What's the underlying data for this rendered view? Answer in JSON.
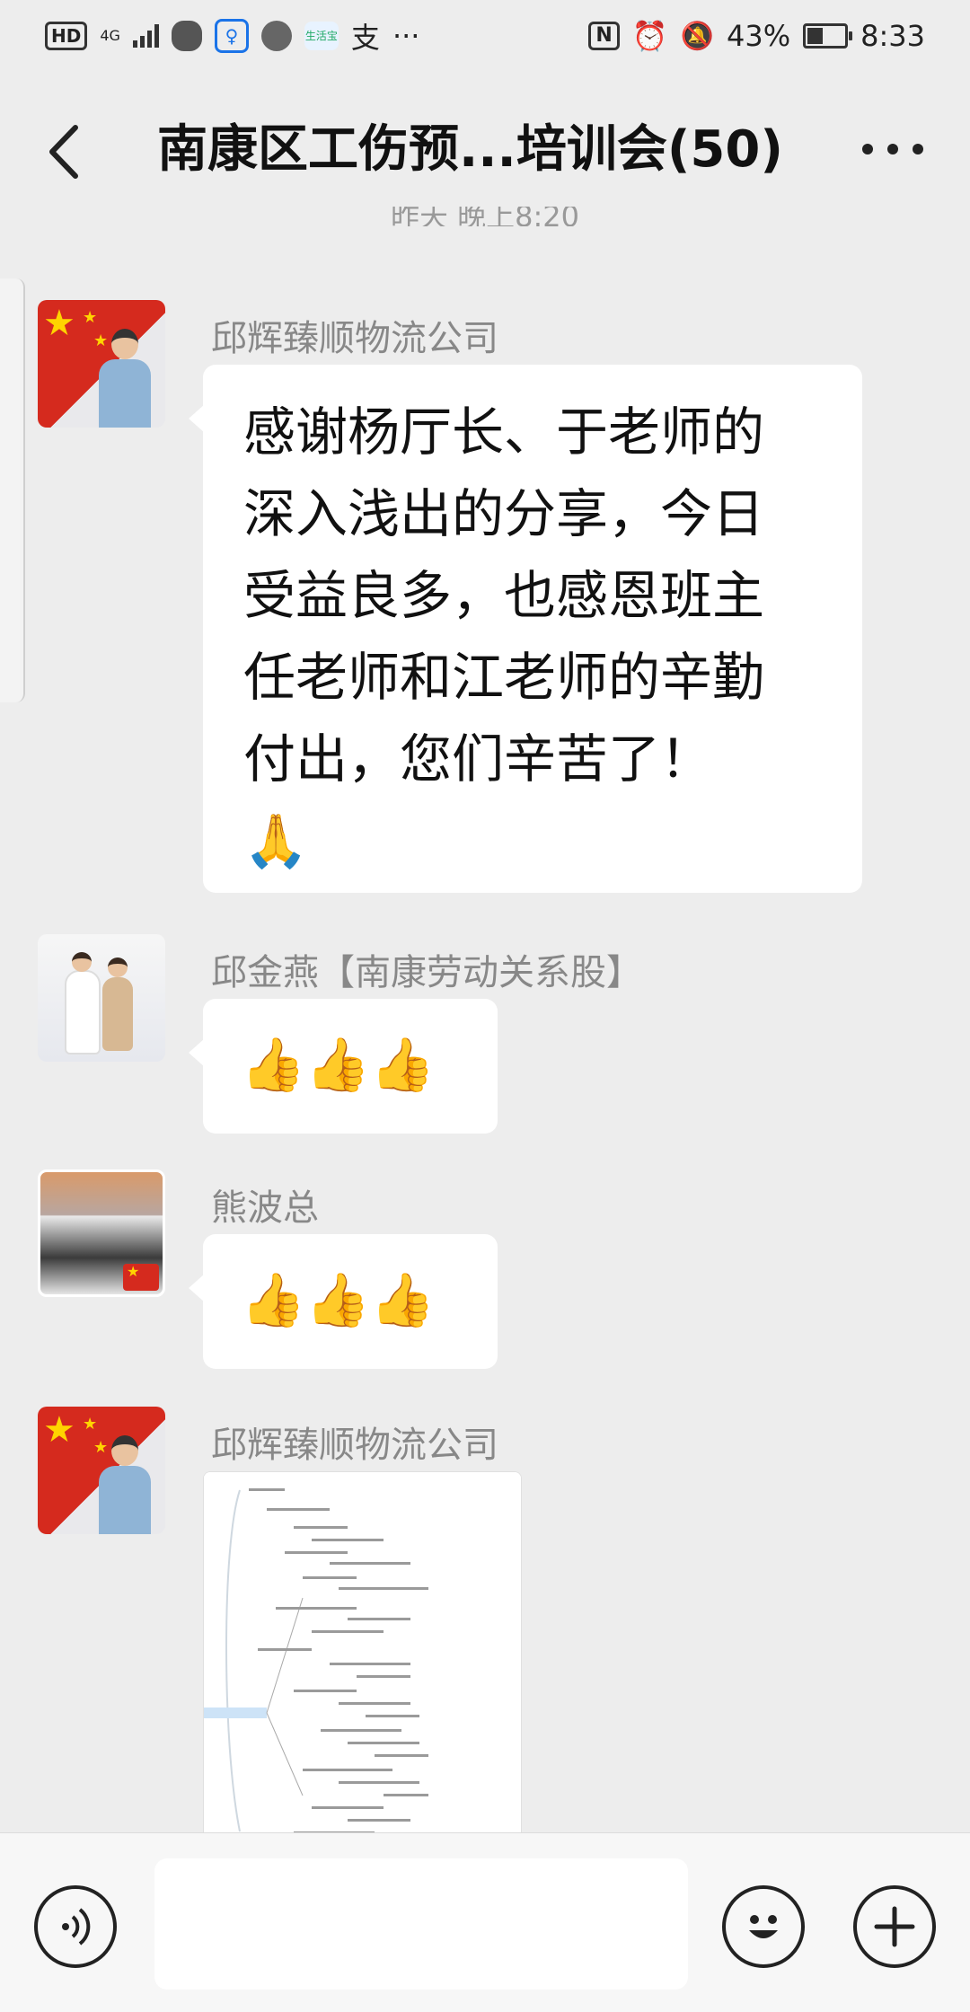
{
  "status_bar": {
    "hd": "HD",
    "network": "4G",
    "app_label": "生活宝",
    "alipay": "支",
    "more": "···",
    "nfc": "N",
    "battery_percent_text": "43%",
    "battery_level": 0.43,
    "time": "8:33"
  },
  "header": {
    "title": "南康区工伤预...培训会(50)",
    "peek_timestamp": "昨天 晚上8:20"
  },
  "messages": [
    {
      "sender": "邱辉臻顺物流公司",
      "text": "感谢杨厅长、于老师的\n深入浅出的分享，今日\n受益良多，也感恩班主\n任老师和江老师的辛勤\n付出，您们辛苦了！\n🙏"
    },
    {
      "sender": "邱金燕【南康劳动关系股】",
      "text": "👍👍👍"
    },
    {
      "sender": "熊波总",
      "text": "👍👍👍"
    },
    {
      "sender": "邱辉臻顺物流公司",
      "image": "mind-map-image"
    }
  ],
  "input": {
    "placeholder": ""
  },
  "icons": {
    "back": "chevron-left-icon",
    "more": "more-dots-icon",
    "voice": "voice-icon",
    "emoji": "emoji-icon",
    "add": "plus-icon"
  }
}
